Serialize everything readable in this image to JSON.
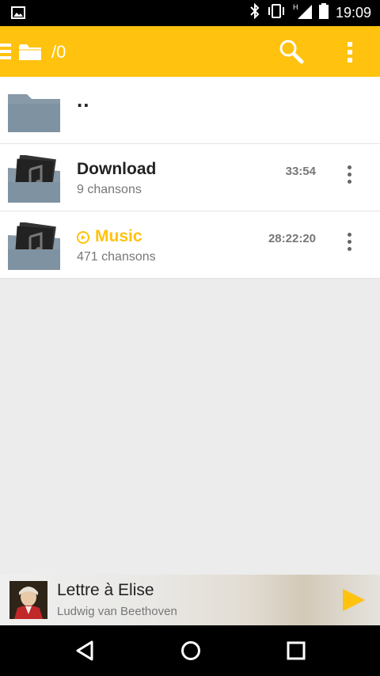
{
  "status_bar": {
    "time": "19:09",
    "icons": [
      "image-icon",
      "bluetooth-icon",
      "vibrate-icon",
      "signal-h-icon",
      "battery-icon"
    ]
  },
  "app_bar": {
    "path": "/0",
    "icons": [
      "menu-icon",
      "folder-icon",
      "search-icon",
      "overflow-menu-icon"
    ],
    "accent_color": "#ffc20e"
  },
  "list": {
    "parent": {
      "label": ".."
    },
    "items": [
      {
        "name": "Download",
        "count": "9 chansons",
        "duration": "33:54",
        "playing": false
      },
      {
        "name": "Music",
        "count": "471 chansons",
        "duration": "28:22:20",
        "playing": true
      }
    ]
  },
  "now_playing": {
    "title": "Lettre à Elise",
    "artist": "Ludwig van Beethoven",
    "play_icon": "play-icon"
  },
  "nav_bar": {
    "icons": [
      "back-icon",
      "home-icon",
      "recents-icon"
    ]
  }
}
